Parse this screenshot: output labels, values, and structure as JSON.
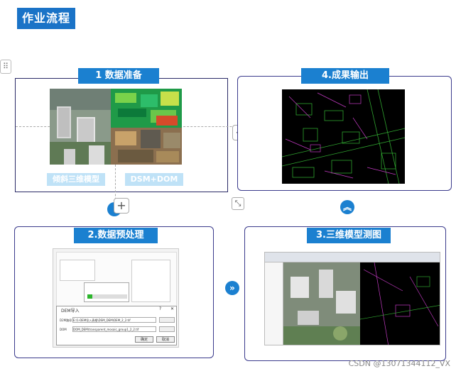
{
  "page": {
    "title": "作业流程"
  },
  "steps": {
    "s1": {
      "label": "1 数据准备",
      "sub_left": "倾斜三维模型",
      "sub_right": "DSM+DOM"
    },
    "s2": {
      "label": "2.数据预处理"
    },
    "s3": {
      "label": "3.三维模型测图"
    },
    "s4": {
      "label": "4.成果输出"
    }
  },
  "dialog": {
    "title": "DEM导入",
    "help": "?",
    "close": "✕",
    "row1_label": "D2M路径",
    "row1_value": "E:\\1-DEM导入表格\\DSM_DEM\\DEM_2_2.tif",
    "row2_label": "DOM",
    "row2_value": "DOM_DEM\\transparent_mosaic_group1_2_2.tif",
    "ok": "确定",
    "cancel": "取消"
  },
  "icons": {
    "drag": "⠿",
    "plus": "+",
    "chevrons_up": "︽",
    "chevrons_right": "»",
    "collapse": "⤡"
  },
  "watermark": "CSDN @13071344112_VX"
}
